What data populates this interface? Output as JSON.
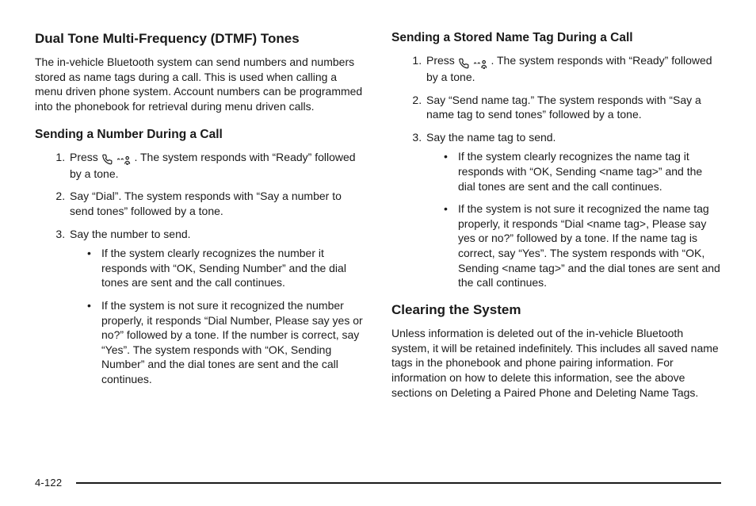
{
  "page_number": "4-122",
  "left": {
    "h2": "Dual Tone Multi-Frequency (DTMF) Tones",
    "intro": "The in-vehicle Bluetooth system can send numbers and numbers stored as name tags during a call. This is used when calling a menu driven phone system. Account numbers can be programmed into the phonebook for retrieval during menu driven calls.",
    "h3": "Sending a Number During a Call",
    "step1_before": "Press ",
    "step1_after": " . The system responds with “Ready” followed by a tone.",
    "step2": "Say “Dial”. The system responds with “Say a number to send tones” followed by a tone.",
    "step3": "Say the number to send.",
    "b1": "If the system clearly recognizes the number it responds with “OK, Sending Number” and the dial tones are sent and the call continues.",
    "b2": "If the system is not sure it recognized the number properly, it responds “Dial Number, Please say yes or no?” followed by a tone. If the number is correct, say “Yes”. The system responds with “OK, Sending Number” and the dial tones are sent and the call continues."
  },
  "right": {
    "h3a": "Sending a Stored Name Tag During a Call",
    "step1_before": "Press ",
    "step1_after": " . The system responds with “Ready” followed by a tone.",
    "step2": "Say “Send name tag.” The system responds with “Say a name tag to send tones” followed by a tone.",
    "step3": "Say the name tag to send.",
    "b1": "If the system clearly recognizes the name tag it responds with “OK, Sending <name tag>” and the dial tones are sent and the call continues.",
    "b2": "If the system is not sure it recognized the name tag properly, it responds “Dial <name tag>, Please say yes or no?” followed by a tone. If the name tag is correct, say “Yes”. The system responds with “OK, Sending <name tag>” and the dial tones are sent and the call continues.",
    "h2b": "Clearing the System",
    "clearing": "Unless information is deleted out of the in-vehicle Bluetooth system, it will be retained indefinitely. This includes all saved name tags in the phonebook and phone pairing information. For information on how to delete this information, see the above sections on Deleting a Paired Phone and Deleting Name Tags."
  }
}
